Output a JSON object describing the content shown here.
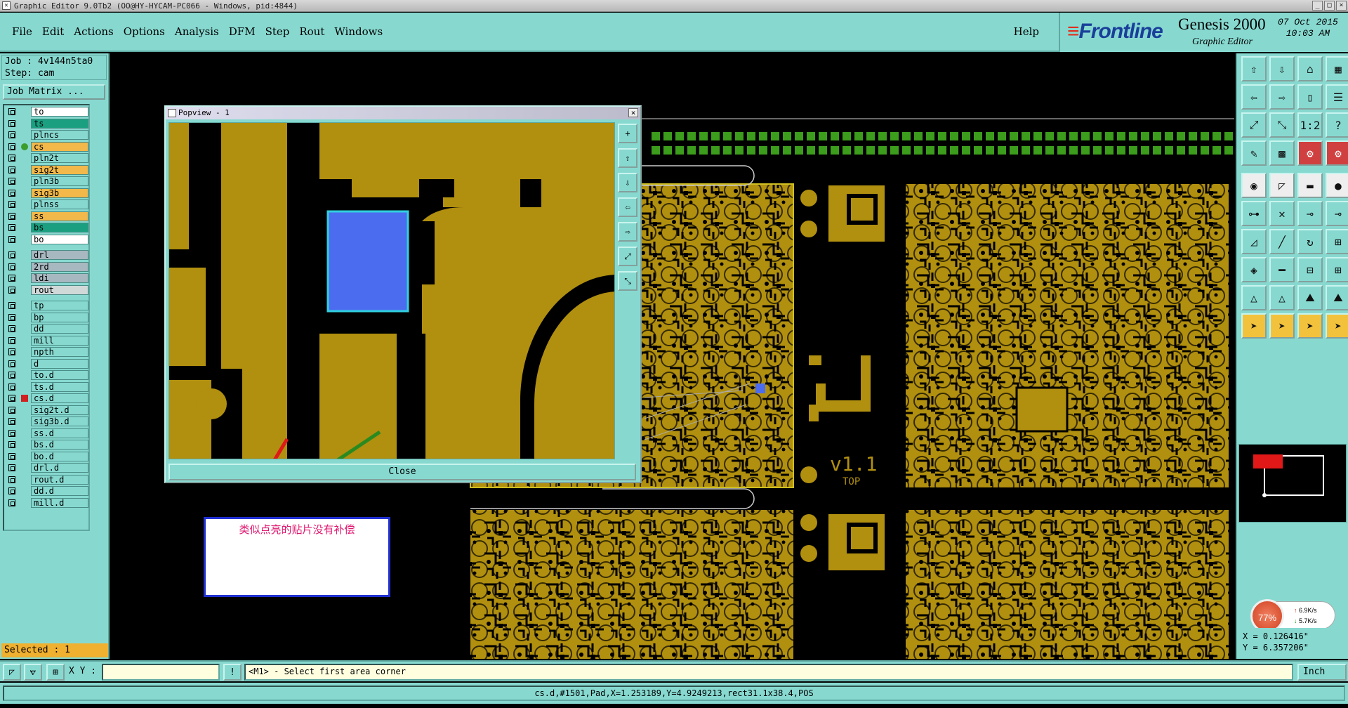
{
  "title_bar": {
    "text": "Graphic Editor 9.0Tb2 (OO@HY-HYCAM-PC066 - Windows, pid:4844)",
    "buttons": [
      "_",
      "□",
      "×"
    ]
  },
  "menu": {
    "items": [
      "File",
      "Edit",
      "Actions",
      "Options",
      "Analysis",
      "DFM",
      "Step",
      "Rout",
      "Windows"
    ],
    "help": "Help"
  },
  "brand": {
    "logo_main": "Frontline",
    "product": "Genesis 2000",
    "subtitle": "Graphic Editor",
    "date": "07 Oct 2015",
    "time": "10:03 AM"
  },
  "job": {
    "job_line": "Job : 4v144n5ta0",
    "step_line": "Step: cam",
    "matrix_button": "Job Matrix ..."
  },
  "layers": [
    {
      "name": "to",
      "color": "#ffffff"
    },
    {
      "name": "ts",
      "color": "#1aa080"
    },
    {
      "name": "plncs",
      "color": "#87d9d0"
    },
    {
      "name": "cs",
      "color": "#f2b84a",
      "active": true
    },
    {
      "name": "pln2t",
      "color": "#87d9d0"
    },
    {
      "name": "sig2t",
      "color": "#f2b84a"
    },
    {
      "name": "pln3b",
      "color": "#87d9d0"
    },
    {
      "name": "sig3b",
      "color": "#f2b84a"
    },
    {
      "name": "plnss",
      "color": "#87d9d0"
    },
    {
      "name": "ss",
      "color": "#f2b84a"
    },
    {
      "name": "bs",
      "color": "#1aa080"
    },
    {
      "name": "bo",
      "color": "#ffffff"
    },
    {
      "name": "drl",
      "color": "#a8b8c0"
    },
    {
      "name": "2rd",
      "color": "#a8b8c0"
    },
    {
      "name": "ldi",
      "color": "#a8b8c0"
    },
    {
      "name": "rout",
      "color": "#d0d8d8"
    },
    {
      "name": "tp",
      "color": "#87d9d0"
    },
    {
      "name": "bp",
      "color": "#87d9d0"
    },
    {
      "name": "dd",
      "color": "#87d9d0"
    },
    {
      "name": "mill",
      "color": "#87d9d0"
    },
    {
      "name": "npth",
      "color": "#87d9d0"
    },
    {
      "name": "d",
      "color": "#87d9d0"
    },
    {
      "name": "to.d",
      "color": "#87d9d0"
    },
    {
      "name": "ts.d",
      "color": "#87d9d0"
    },
    {
      "name": "cs.d",
      "color": "#87d9d0",
      "affected": true
    },
    {
      "name": "sig2t.d",
      "color": "#87d9d0"
    },
    {
      "name": "sig3b.d",
      "color": "#87d9d0"
    },
    {
      "name": "ss.d",
      "color": "#87d9d0"
    },
    {
      "name": "bs.d",
      "color": "#87d9d0"
    },
    {
      "name": "bo.d",
      "color": "#87d9d0"
    },
    {
      "name": "drl.d",
      "color": "#87d9d0"
    },
    {
      "name": "rout.d",
      "color": "#87d9d0"
    },
    {
      "name": "dd.d",
      "color": "#87d9d0"
    },
    {
      "name": "mill.d",
      "color": "#87d9d0"
    }
  ],
  "selected_count": "Selected : 1",
  "popview": {
    "title": "Popview - 1",
    "close_label": "Close",
    "close_x": "×",
    "tools": [
      "+",
      "⇧",
      "⇩",
      "⇦",
      "⇨",
      "⤢",
      "⤡"
    ]
  },
  "note": {
    "text": "类似点亮的贴片没有补偿"
  },
  "board": {
    "silk_version": "v1.1",
    "silk_side": "TOP"
  },
  "toolbox": {
    "icons": [
      "⇧",
      "⇩",
      "⌂",
      "▦",
      "⇦",
      "⇨",
      "▯",
      "☰",
      "⤢",
      "⤡",
      "1:2",
      "?",
      "✎",
      "▩",
      "⚙",
      "⚙",
      "◉",
      "◸",
      "▬",
      "●",
      "⊶",
      "✕",
      "⊸",
      "⊸",
      "◿",
      "╱",
      "↻",
      "⊞",
      "◈",
      "━",
      "⊟",
      "⊞",
      "△",
      "△",
      "⛰",
      "⛰",
      "➤",
      "➤",
      "➤",
      "➤"
    ]
  },
  "coords": {
    "x": "X = 0.126416\"",
    "y": "Y = 6.357206\""
  },
  "speed": {
    "percent": "77%",
    "up": "6.9K/s",
    "down": "5.7K/s"
  },
  "status": {
    "xy_label": "X Y :",
    "xy_value": "",
    "prompt": "<M1> - Select first area corner",
    "units": "Inch"
  },
  "info_line": "cs.d,#1501,Pad,X=1.253189,Y=4.9249213,rect31.1x38.4,POS",
  "colors": {
    "panel": "#87d9d0",
    "copper": "#b18f0f",
    "highlight": "#4c6cf0"
  }
}
